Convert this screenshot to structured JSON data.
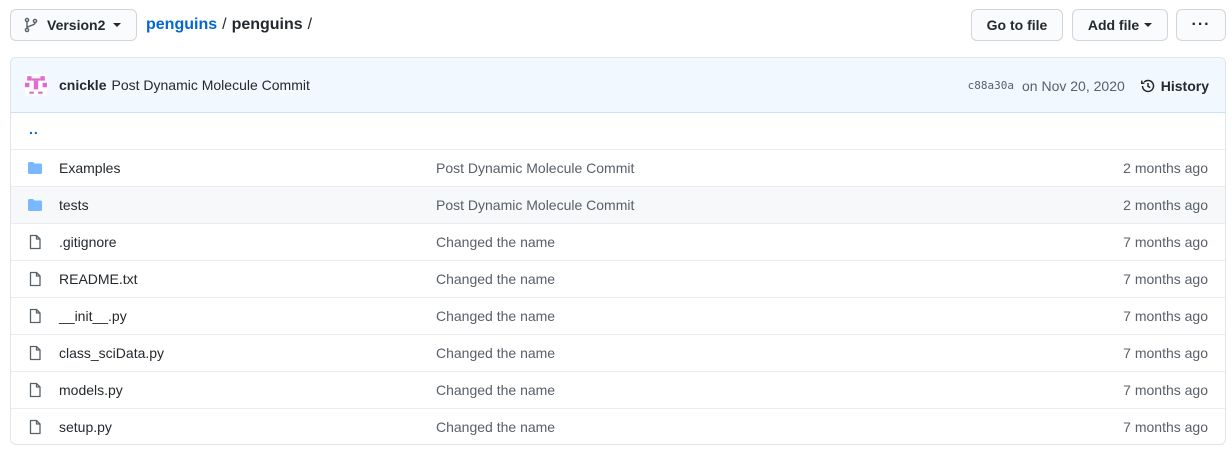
{
  "toolbar": {
    "branch": "Version2",
    "breadcrumb": {
      "repo": "penguins",
      "separator": "/",
      "current": "penguins",
      "trailing": "/"
    },
    "goto_file": "Go to file",
    "add_file": "Add file",
    "more": "···"
  },
  "commit": {
    "author": "cnickle",
    "message": "Post Dynamic Molecule Commit",
    "sha": "c88a30a",
    "date": "on Nov 20, 2020",
    "history": "History"
  },
  "parent_dir": "..",
  "files": [
    {
      "type": "folder",
      "name": "Examples",
      "message": "Post Dynamic Molecule Commit",
      "age": "2 months ago"
    },
    {
      "type": "folder",
      "name": "tests",
      "message": "Post Dynamic Molecule Commit",
      "age": "2 months ago"
    },
    {
      "type": "file",
      "name": ".gitignore",
      "message": "Changed the name",
      "age": "7 months ago"
    },
    {
      "type": "file",
      "name": "README.txt",
      "message": "Changed the name",
      "age": "7 months ago"
    },
    {
      "type": "file",
      "name": "__init__.py",
      "message": "Changed the name",
      "age": "7 months ago"
    },
    {
      "type": "file",
      "name": "class_sciData.py",
      "message": "Changed the name",
      "age": "7 months ago"
    },
    {
      "type": "file",
      "name": "models.py",
      "message": "Changed the name",
      "age": "7 months ago"
    },
    {
      "type": "file",
      "name": "setup.py",
      "message": "Changed the name",
      "age": "7 months ago"
    }
  ],
  "colors": {
    "link": "#0366d6",
    "folder_icon": "#79b8ff",
    "commit_bar_bg": "#f1f8ff",
    "avatar": "#e26bd0"
  },
  "icons": {
    "branch": "git-branch-icon",
    "folder": "folder-icon",
    "file": "file-icon",
    "history": "history-clock-icon"
  }
}
